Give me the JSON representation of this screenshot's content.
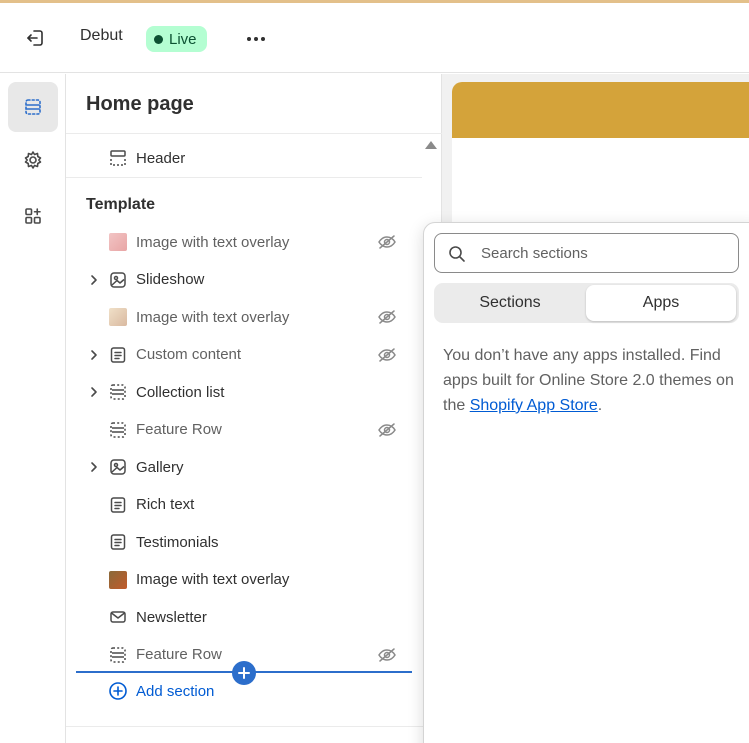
{
  "topbar": {
    "theme_name": "Debut",
    "status_badge": "Live"
  },
  "panel": {
    "title": "Home page",
    "header_section": "Header",
    "template_label": "Template",
    "sections": [
      {
        "label": "Image with text overlay",
        "icon": "image-thumbnail-icon",
        "expandable": false,
        "hidden": true
      },
      {
        "label": "Slideshow",
        "icon": "slideshow-icon",
        "expandable": true,
        "hidden": false
      },
      {
        "label": "Image with text overlay",
        "icon": "image-thumbnail-icon",
        "expandable": false,
        "hidden": true
      },
      {
        "label": "Custom content",
        "icon": "text-block-icon",
        "expandable": true,
        "hidden": true
      },
      {
        "label": "Collection list",
        "icon": "section-icon",
        "expandable": true,
        "hidden": false
      },
      {
        "label": "Feature Row",
        "icon": "section-icon",
        "expandable": false,
        "hidden": true
      },
      {
        "label": "Gallery",
        "icon": "gallery-icon",
        "expandable": true,
        "hidden": false
      },
      {
        "label": "Rich text",
        "icon": "text-block-icon",
        "expandable": false,
        "hidden": false
      },
      {
        "label": "Testimonials",
        "icon": "text-block-icon",
        "expandable": false,
        "hidden": false
      },
      {
        "label": "Image with text overlay",
        "icon": "image-thumbnail-icon",
        "expandable": false,
        "hidden": false
      },
      {
        "label": "Newsletter",
        "icon": "envelope-icon",
        "expandable": false,
        "hidden": false
      },
      {
        "label": "Feature Row",
        "icon": "section-icon",
        "expandable": false,
        "hidden": true
      }
    ],
    "add_section": "Add section"
  },
  "popover": {
    "search_placeholder": "Search sections",
    "tabs": [
      "Sections",
      "Apps"
    ],
    "selected_tab": "Apps",
    "empty_text": "You don’t have any apps installed. Find apps built for Online Store 2.0 themes on the ",
    "link_text": "Shopify App Store",
    "empty_suffix": "."
  },
  "colors": {
    "accent": "#2c6ecb",
    "live_badge_bg": "#b4fed2",
    "preview_banner": "#d4a33a"
  }
}
